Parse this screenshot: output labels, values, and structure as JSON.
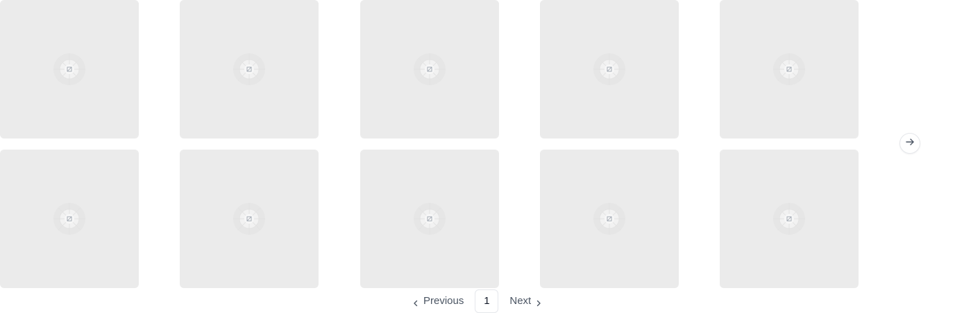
{
  "gallery": {
    "rows": 2,
    "columns": 5,
    "tile_count": 10,
    "tile_color": "#ebebeb",
    "placeholder_icon": "image-placeholder-icon"
  },
  "carousel": {
    "next_icon": "arrow-right-icon"
  },
  "pagination": {
    "previous_label": "Previous",
    "current_page": "1",
    "next_label": "Next",
    "previous_icon": "chevron-left-icon",
    "next_icon": "chevron-right-icon"
  }
}
